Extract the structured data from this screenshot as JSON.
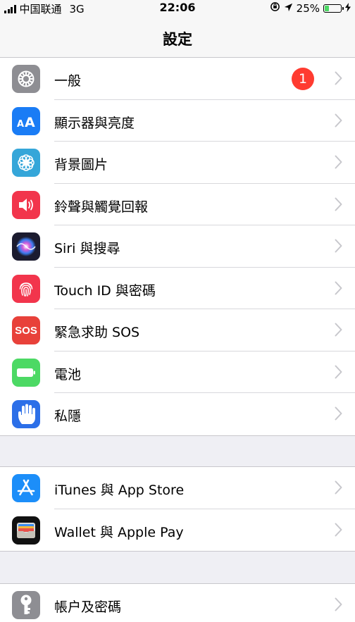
{
  "status_bar": {
    "carrier": "中国联通",
    "network": "3G",
    "time": "22:06",
    "battery_percent": "25%",
    "battery_level": 0.25
  },
  "nav": {
    "title": "設定"
  },
  "groups": [
    {
      "rows": [
        {
          "label": "一般",
          "icon": "gear-icon",
          "color": "#8e8e93",
          "badge": "1"
        },
        {
          "label": "顯示器與亮度",
          "icon": "text-size-icon",
          "color": "#1a7cf5"
        },
        {
          "label": "背景圖片",
          "icon": "flower-icon",
          "color": "#35a6d9"
        },
        {
          "label": "鈴聲與觸覺回報",
          "icon": "speaker-icon",
          "color": "#f2354c"
        },
        {
          "label": "Siri 與搜尋",
          "icon": "siri-icon",
          "color": "#1b1b2f"
        },
        {
          "label": "Touch ID 與密碼",
          "icon": "fingerprint-icon",
          "color": "#f2354c"
        },
        {
          "label": "緊急求助 SOS",
          "icon": "sos-icon",
          "color": "#e8413a",
          "icon_text": "SOS"
        },
        {
          "label": "電池",
          "icon": "battery-icon",
          "color": "#4cd964"
        },
        {
          "label": "私隱",
          "icon": "hand-icon",
          "color": "#2c6fe8"
        }
      ]
    },
    {
      "rows": [
        {
          "label": "iTunes 與 App Store",
          "icon": "app-store-icon",
          "color": "#1c8ef9"
        },
        {
          "label": "Wallet 與 Apple Pay",
          "icon": "wallet-icon",
          "color": "#111111"
        }
      ]
    },
    {
      "rows": [
        {
          "label": "帳户及密碼",
          "icon": "key-icon",
          "color": "#8e8e93"
        }
      ]
    }
  ]
}
